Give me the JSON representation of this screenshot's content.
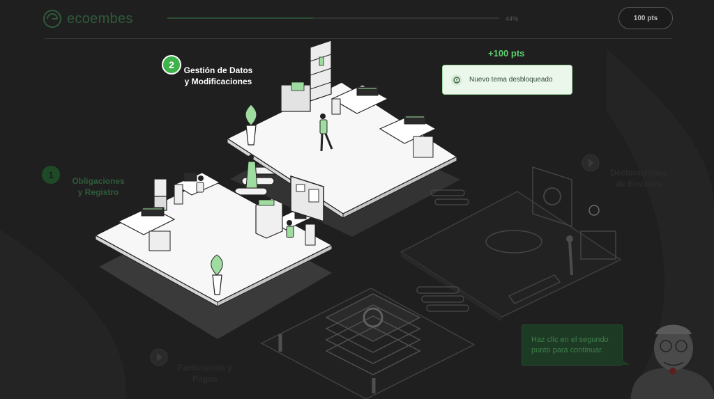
{
  "header": {
    "logo_text": "ecoembes",
    "progress": {
      "percent": 0.44,
      "label": "44%"
    },
    "points_button": "100 pts"
  },
  "steps": [
    {
      "number": "1",
      "label_line1": "Obligaciones",
      "label_line2": "y Registro",
      "state": "done"
    },
    {
      "number": "2",
      "label_line1": "Gestión de Datos",
      "label_line2": "y Modificaciones",
      "state": "active"
    },
    {
      "number": "",
      "label_line1": "Declaraciones",
      "label_line2": "de Envases",
      "state": "locked"
    },
    {
      "number": "",
      "label_line1": "Facturación y",
      "label_line2": "Pagos",
      "state": "locked"
    }
  ],
  "notification": {
    "points": "+100 pts",
    "text": "Nuevo tema desbloqueado",
    "icon": "info-icon"
  },
  "guide": {
    "bubble_text": "Haz clic en el segundo punto para continuar."
  },
  "colors": {
    "accent": "#3db34a",
    "background": "#1f1f1f",
    "toast_bg": "#eaf7ea",
    "toast_border": "#9fdc9f",
    "bubble_bg": "#1d3b24"
  }
}
